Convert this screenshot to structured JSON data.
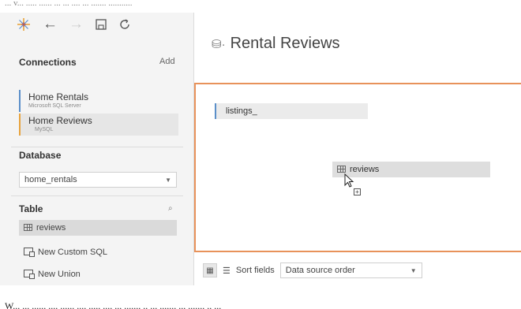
{
  "top_text": "... v... ..... ...... ... ... .... ... ....... ...........",
  "bottom_text": "W... ... ...... .... ...... .... ..... .... ... ....... .. ... ....... ... ....... .. ...",
  "toolbar": {
    "logo": "tableau-logo-icon",
    "back": "←",
    "forward": "→",
    "save": "save-icon",
    "refresh": "refresh-icon"
  },
  "connections": {
    "title": "Connections",
    "add_label": "Add",
    "items": [
      {
        "name": "Home Rentals",
        "type": "Microsoft SQL Server"
      },
      {
        "name": "Home Reviews",
        "type": "MySQL"
      }
    ]
  },
  "database": {
    "title": "Database",
    "selected": "home_rentals"
  },
  "table": {
    "title": "Table",
    "search_icon": "search-icon",
    "items": [
      "reviews"
    ],
    "new_custom_sql": "New Custom SQL",
    "new_union": "New Union"
  },
  "main": {
    "title": "Rental Reviews"
  },
  "canvas": {
    "table_listing": "listings_",
    "table_dragging": "reviews"
  },
  "bottom_bar": {
    "sort_label": "Sort fields",
    "sort_value": "Data source order"
  },
  "colors": {
    "accent_blue": "#5b8fc9",
    "accent_orange": "#e8a33d",
    "canvas_border": "#e8925a"
  }
}
